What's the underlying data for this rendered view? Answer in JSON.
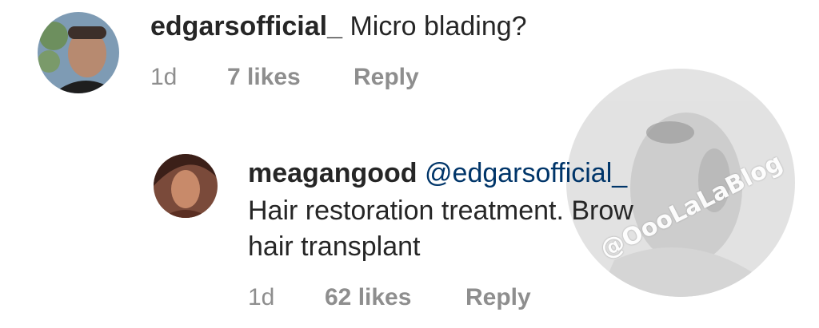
{
  "comments": [
    {
      "username": "edgarsofficial_",
      "text": "Micro blading?",
      "time": "1d",
      "likes": "7 likes",
      "reply": "Reply",
      "avatar": "avatar-man-photo"
    },
    {
      "username": "meagangood",
      "mention": "@edgarsofficial_",
      "text_line1": "Hair restoration treatment. Brow",
      "text_line2": "hair transplant",
      "time": "1d",
      "likes": "62 likes",
      "reply": "Reply",
      "avatar": "avatar-woman-photo"
    }
  ],
  "watermark": {
    "text": "@OooLaLaBlog",
    "color": "#d9d9d9"
  },
  "colors": {
    "text": "#262626",
    "meta": "#8e8e8e",
    "mention": "#003569"
  }
}
